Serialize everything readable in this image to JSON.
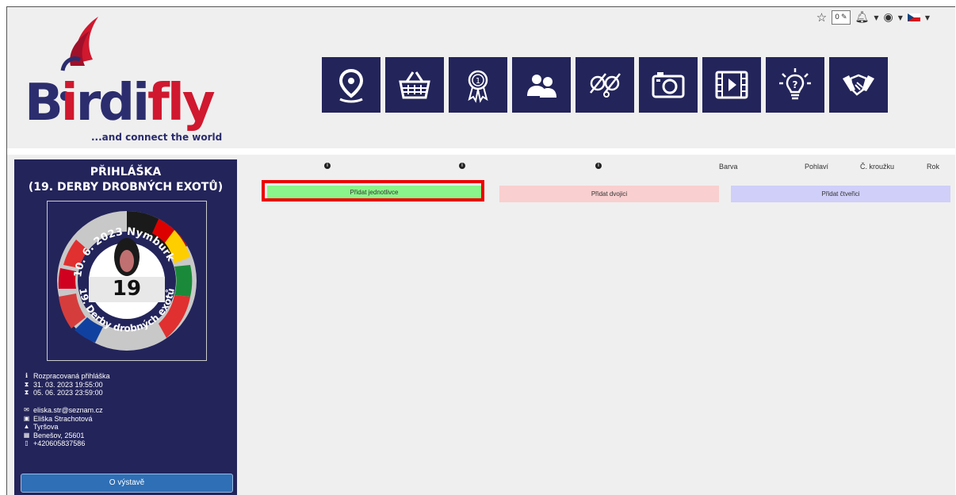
{
  "brand": {
    "logo_main": "Birdifly",
    "logo_tagline": "...and connect the world"
  },
  "topbar": {
    "cart_count": "0",
    "colors": {
      "header_bg": "#23245a",
      "red": "#d0182e"
    }
  },
  "nav_icons": [
    "location-icon",
    "basket-icon",
    "award-icon",
    "users-icon",
    "ring-icon",
    "camera-icon",
    "video-icon",
    "idea-icon",
    "handshake-icon"
  ],
  "sidebar": {
    "title_line1": "PŘIHLÁŠKA",
    "title_line2": "(19. DERBY DROBNÝCH EXOTŮ)",
    "emblem": {
      "date_place": "10. 6. 2023 Nymburk",
      "number": "19",
      "event": "19. Derby drobných exotů"
    },
    "status": "Rozpracovaná přihláška",
    "date_start": "31. 03. 2023 19:55:00",
    "date_end": "05. 06. 2023 23:59:00",
    "email": "eliska.str@seznam.cz",
    "name": "Eliška Strachotová",
    "street": "Tyršova",
    "city": "Benešov, 25601",
    "phone": "+420605837586",
    "about_button": "O výstavě"
  },
  "table": {
    "headers": {
      "barva": "Barva",
      "pohlavi": "Pohlaví",
      "krouzek": "Č. kroužku",
      "rok": "Rok"
    },
    "buttons": {
      "single": "Přidat jednotlivce",
      "pair": "Přidat dvojici",
      "quad": "Přidat čtveřici"
    },
    "button_colors": {
      "single": "#8af58a",
      "pair": "#f9cfcf",
      "quad": "#cfcff9"
    }
  }
}
